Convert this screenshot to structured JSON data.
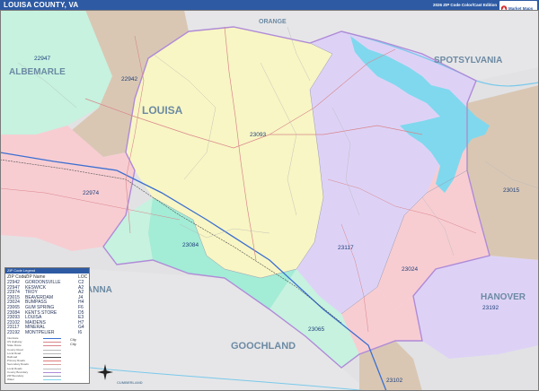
{
  "header": {
    "title": "LOUISA COUNTY, VA",
    "edition": "2026 ZIP Code Color/Cast Edition",
    "logo_text": "Market Maps"
  },
  "map": {
    "counties": [
      {
        "name": "ORANGE"
      },
      {
        "name": "ALBEMARLE"
      },
      {
        "name": "SPOTSYLVANIA"
      },
      {
        "name": "LOUISA"
      },
      {
        "name": "HANOVER"
      },
      {
        "name": "GOOCHLAND"
      },
      {
        "name": "ANNA"
      },
      {
        "name": "CUMBERLAND"
      }
    ],
    "zips": [
      {
        "code": "22947"
      },
      {
        "code": "22942"
      },
      {
        "code": "23093"
      },
      {
        "code": "22974"
      },
      {
        "code": "23084"
      },
      {
        "code": "23117"
      },
      {
        "code": "23024"
      },
      {
        "code": "23015"
      },
      {
        "code": "23192"
      },
      {
        "code": "23065"
      },
      {
        "code": "23102"
      }
    ],
    "colors": {
      "yellow": "#f8f6c4",
      "purple": "#ddd2f6",
      "pink": "#f7cdd2",
      "green": "#c6f2df",
      "tan": "#d9c7b4",
      "teal": "#a3ecd6",
      "water": "#7fd8ee"
    }
  },
  "legend": {
    "title": "ZIP Code Legend",
    "headers": {
      "zip": "ZIP Code",
      "name": "ZIP Name",
      "grid": "LOC"
    },
    "rows": [
      {
        "zip": "22942",
        "name": "GORDONSVILLE",
        "grid": "C2"
      },
      {
        "zip": "22947",
        "name": "KESWICK",
        "grid": "A2"
      },
      {
        "zip": "22974",
        "name": "TROY",
        "grid": "A2"
      },
      {
        "zip": "23015",
        "name": "BEAVERDAM",
        "grid": "J4"
      },
      {
        "zip": "23024",
        "name": "BUMPASS",
        "grid": "H4"
      },
      {
        "zip": "23065",
        "name": "GUM SPRING",
        "grid": "F6"
      },
      {
        "zip": "23084",
        "name": "KENTS STORE",
        "grid": "D5"
      },
      {
        "zip": "23093",
        "name": "LOUISA",
        "grid": "E3"
      },
      {
        "zip": "23102",
        "name": "MAIDENS",
        "grid": "H7"
      },
      {
        "zip": "23117",
        "name": "MINERAL",
        "grid": "G4"
      },
      {
        "zip": "23192",
        "name": "MONTPELIER",
        "grid": "I6"
      }
    ],
    "line_items": [
      "Interstate",
      "US Highway",
      "State Route",
      "County Road",
      "Local Road",
      "Railroad",
      "Primary Roads",
      "Secondary Roads",
      "Local Roads",
      "County Boundary",
      "ZIP Boundary",
      "Water"
    ],
    "city_label": "City",
    "city_sub": "City"
  }
}
